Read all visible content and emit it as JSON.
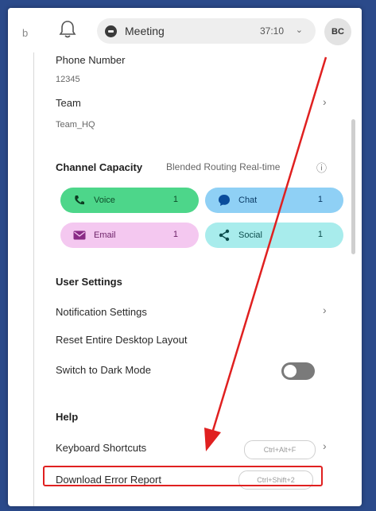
{
  "header": {
    "left_glyph": "b",
    "meeting_label": "Meeting",
    "timer": "37:10",
    "timer_chevron": "⌄",
    "avatar_initials": "BC"
  },
  "profile": {
    "phone_label": "Phone Number",
    "phone_value": "12345",
    "team_label": "Team",
    "team_value": "Team_HQ"
  },
  "channel_capacity": {
    "title": "Channel Capacity",
    "mode": "Blended Routing Real-time",
    "info_icon": "ⓘ",
    "channels": [
      {
        "name": "Voice",
        "count": "1",
        "icon": "phone-icon",
        "bg": "#4dd68a",
        "fg": "#0d4d2a"
      },
      {
        "name": "Chat",
        "count": "1",
        "icon": "chat-bubble-icon",
        "bg": "#8fd0f5",
        "fg": "#0a3b66"
      },
      {
        "name": "Email",
        "count": "1",
        "icon": "email-icon",
        "bg": "#f4c8f0",
        "fg": "#6b1f66"
      },
      {
        "name": "Social",
        "count": "1",
        "icon": "share-icon",
        "bg": "#a8ecec",
        "fg": "#0c4d4d"
      }
    ]
  },
  "user_settings": {
    "title": "User Settings",
    "notification": "Notification Settings",
    "reset_layout": "Reset Entire Desktop Layout",
    "dark_mode": "Switch to Dark Mode"
  },
  "help": {
    "title": "Help",
    "keyboard_shortcuts": "Keyboard Shortcuts",
    "keyboard_shortcut_keys": "Ctrl+Alt+F",
    "download_error_report": "Download Error Report",
    "download_shortcut_keys": "Ctrl+Shift+2"
  },
  "chevron": "›",
  "colors": {
    "annotation": "#e02020",
    "toggle_off": "#7a7a7a",
    "page_bg": "#2b4a8a"
  }
}
